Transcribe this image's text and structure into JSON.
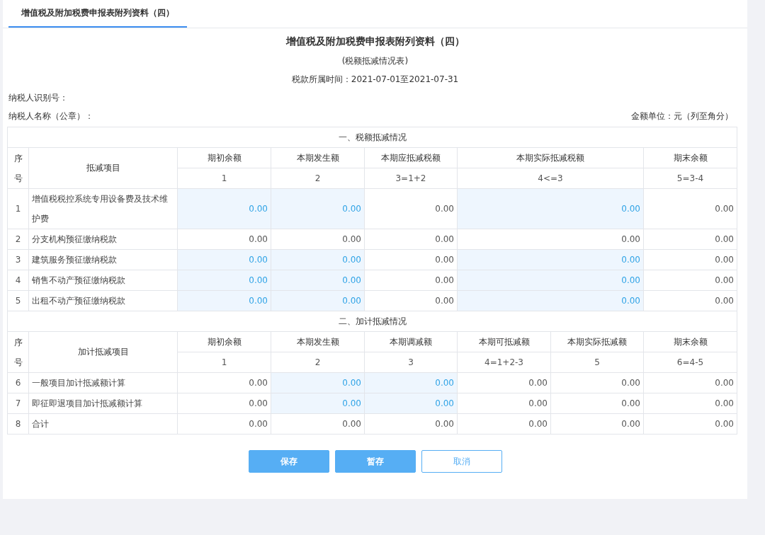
{
  "tabs": [
    {
      "label": "增值税及附加税费申报表附列资料（四）",
      "selected": true
    }
  ],
  "title": "增值税及附加税费申报表附列资料（四）",
  "subtitle": "(税额抵减情况表)",
  "period": "税款所属时间：2021-07-01至2021-07-31",
  "taxpayer_id_label": "纳税人识别号：",
  "taxpayer_name_label": "纳税人名称（公章）：",
  "unit_note": "金额单位：元（列至角分）",
  "sections": [
    {
      "title": "一、税额抵减情况",
      "seq_header": "序号",
      "item_header": "抵减项目",
      "columns": [
        {
          "label": "期初余额",
          "formula": "1"
        },
        {
          "label": "本期发生额",
          "formula": "2"
        },
        {
          "label": "本期应抵减税额",
          "formula": "3=1+2"
        },
        {
          "label": "本期实际抵减税额",
          "formula": "4<=3"
        },
        {
          "label": "期末余额",
          "formula": "5=3-4"
        }
      ],
      "rows": [
        {
          "no": "1",
          "item": "增值税税控系统专用设备费及技术维护费",
          "cells": [
            {
              "value": "0.00",
              "editable": true
            },
            {
              "value": "0.00",
              "editable": true
            },
            {
              "value": "0.00",
              "editable": false
            },
            {
              "value": "0.00",
              "editable": true
            },
            {
              "value": "0.00",
              "editable": false
            }
          ]
        },
        {
          "no": "2",
          "item": "分支机构预征缴纳税款",
          "cells": [
            {
              "value": "0.00",
              "editable": false
            },
            {
              "value": "0.00",
              "editable": false
            },
            {
              "value": "0.00",
              "editable": false
            },
            {
              "value": "0.00",
              "editable": false
            },
            {
              "value": "0.00",
              "editable": false
            }
          ]
        },
        {
          "no": "3",
          "item": "建筑服务预征缴纳税款",
          "cells": [
            {
              "value": "0.00",
              "editable": true
            },
            {
              "value": "0.00",
              "editable": true
            },
            {
              "value": "0.00",
              "editable": false
            },
            {
              "value": "0.00",
              "editable": true
            },
            {
              "value": "0.00",
              "editable": false
            }
          ]
        },
        {
          "no": "4",
          "item": "销售不动产预征缴纳税款",
          "cells": [
            {
              "value": "0.00",
              "editable": true
            },
            {
              "value": "0.00",
              "editable": true
            },
            {
              "value": "0.00",
              "editable": false
            },
            {
              "value": "0.00",
              "editable": true
            },
            {
              "value": "0.00",
              "editable": false
            }
          ]
        },
        {
          "no": "5",
          "item": "出租不动产预征缴纳税款",
          "cells": [
            {
              "value": "0.00",
              "editable": true
            },
            {
              "value": "0.00",
              "editable": true
            },
            {
              "value": "0.00",
              "editable": false
            },
            {
              "value": "0.00",
              "editable": true
            },
            {
              "value": "0.00",
              "editable": false
            }
          ]
        }
      ]
    },
    {
      "title": "二、加计抵减情况",
      "seq_header": "序号",
      "item_header": "加计抵减项目",
      "columns": [
        {
          "label": "期初余额",
          "formula": "1"
        },
        {
          "label": "本期发生额",
          "formula": "2"
        },
        {
          "label": "本期调减额",
          "formula": "3"
        },
        {
          "label": "本期可抵减额",
          "formula": "4=1+2-3"
        },
        {
          "label": "本期实际抵减额",
          "formula": "5"
        },
        {
          "label": "期末余额",
          "formula": "6=4-5"
        }
      ],
      "rows": [
        {
          "no": "6",
          "item": "一般项目加计抵减额计算",
          "cells": [
            {
              "value": "0.00",
              "editable": false
            },
            {
              "value": "0.00",
              "editable": true
            },
            {
              "value": "0.00",
              "editable": true
            },
            {
              "value": "0.00",
              "editable": false
            },
            {
              "value": "0.00",
              "editable": false
            },
            {
              "value": "0.00",
              "editable": false
            }
          ]
        },
        {
          "no": "7",
          "item": "即征即退项目加计抵减额计算",
          "cells": [
            {
              "value": "0.00",
              "editable": false
            },
            {
              "value": "0.00",
              "editable": true
            },
            {
              "value": "0.00",
              "editable": true
            },
            {
              "value": "0.00",
              "editable": false
            },
            {
              "value": "0.00",
              "editable": false
            },
            {
              "value": "0.00",
              "editable": false
            }
          ]
        },
        {
          "no": "8",
          "item": "合计",
          "cells": [
            {
              "value": "0.00",
              "editable": false
            },
            {
              "value": "0.00",
              "editable": false
            },
            {
              "value": "0.00",
              "editable": false
            },
            {
              "value": "0.00",
              "editable": false
            },
            {
              "value": "0.00",
              "editable": false
            },
            {
              "value": "0.00",
              "editable": false
            }
          ]
        }
      ]
    }
  ],
  "buttons": [
    {
      "label": "保存",
      "kind": "primary"
    },
    {
      "label": "暂存",
      "kind": "primary"
    },
    {
      "label": "取消",
      "kind": "default"
    }
  ]
}
